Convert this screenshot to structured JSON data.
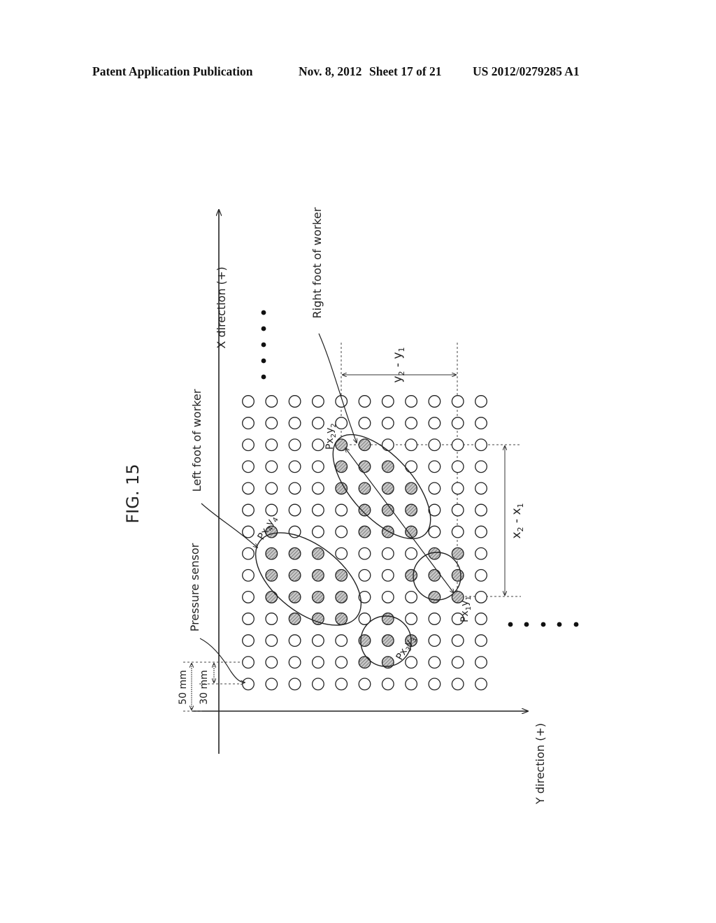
{
  "header": {
    "publication": "Patent Application Publication",
    "date": "Nov. 8, 2012",
    "sheet": "Sheet 17 of 21",
    "number": "US 2012/0279285 A1"
  },
  "figure": {
    "title": "FIG. 15",
    "x_axis_label": "X direction (+)",
    "y_axis_label": "Y direction (+)",
    "labels": {
      "pressure_sensor": "Pressure sensor",
      "left_foot": "Left foot of worker",
      "right_foot": "Right foot of worker"
    },
    "dimensions": {
      "pitch_50": "50 mm",
      "pitch_30": "30 mm",
      "dx": {
        "a": "x",
        "a_sub": "2",
        "mid": " - ",
        "b": "x",
        "b_sub": "1"
      },
      "dy": {
        "a": "y",
        "a_sub": "2",
        "mid": " - ",
        "b": "y",
        "b_sub": "1"
      }
    },
    "points": [
      {
        "id": "p1",
        "main": "Px",
        "s1": "1",
        "m2": "y",
        "s2": "1"
      },
      {
        "id": "p2",
        "main": "Px",
        "s1": "2",
        "m2": "y",
        "s2": "2"
      },
      {
        "id": "p3",
        "main": "Px",
        "s1": "3",
        "m2": "y",
        "s2": "3"
      },
      {
        "id": "p4",
        "main": "Px",
        "s1": "4",
        "m2": "y",
        "s2": "4"
      }
    ],
    "grid": {
      "columns": 11,
      "rows": 14,
      "shaded": [
        [
          2,
          4
        ],
        [
          2,
          5
        ],
        [
          3,
          4
        ],
        [
          3,
          5
        ],
        [
          3,
          6
        ],
        [
          4,
          4
        ],
        [
          4,
          5
        ],
        [
          4,
          6
        ],
        [
          4,
          7
        ],
        [
          5,
          5
        ],
        [
          5,
          6
        ],
        [
          5,
          7
        ],
        [
          6,
          1
        ],
        [
          6,
          5
        ],
        [
          6,
          6
        ],
        [
          6,
          7
        ],
        [
          7,
          1
        ],
        [
          7,
          2
        ],
        [
          7,
          3
        ],
        [
          7,
          8
        ],
        [
          7,
          9
        ],
        [
          8,
          1
        ],
        [
          8,
          2
        ],
        [
          8,
          3
        ],
        [
          8,
          4
        ],
        [
          8,
          7
        ],
        [
          8,
          8
        ],
        [
          8,
          9
        ],
        [
          9,
          1
        ],
        [
          9,
          2
        ],
        [
          9,
          3
        ],
        [
          9,
          4
        ],
        [
          9,
          8
        ],
        [
          9,
          9
        ],
        [
          10,
          2
        ],
        [
          10,
          3
        ],
        [
          10,
          4
        ],
        [
          10,
          6
        ],
        [
          11,
          5
        ],
        [
          11,
          6
        ],
        [
          11,
          7
        ],
        [
          12,
          5
        ],
        [
          12,
          6
        ]
      ]
    }
  }
}
